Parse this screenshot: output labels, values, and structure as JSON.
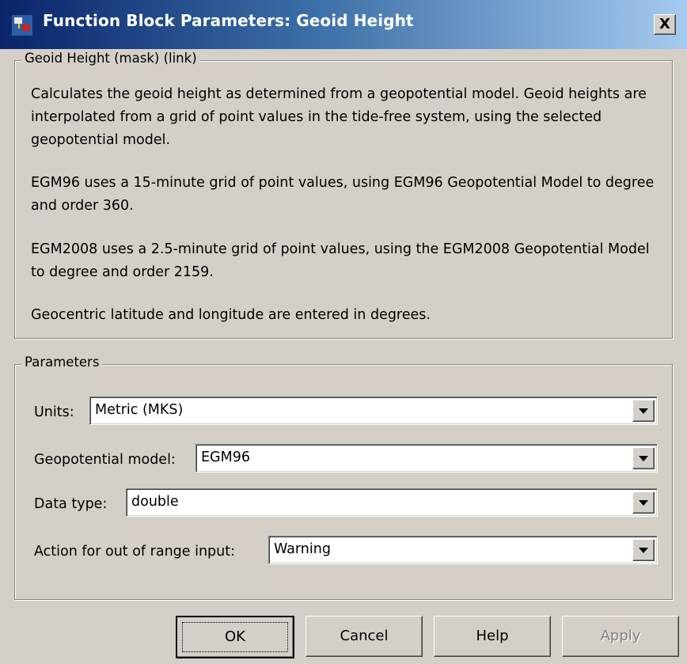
{
  "window": {
    "title": "Function Block Parameters: Geoid Height",
    "close_label": "X"
  },
  "description_group": {
    "legend": "Geoid Height (mask) (link)",
    "paragraphs": [
      "Calculates the geoid height as determined from a geopotential model. Geoid heights are interpolated from a grid of point values in the tide-free system, using the selected geopotential model.",
      "EGM96 uses a 15-minute grid of point values, using EGM96 Geopotential Model to degree and order 360.",
      "EGM2008 uses a 2.5-minute grid of point values, using the EGM2008 Geopotential Model to degree and order 2159.",
      "Geocentric latitude and longitude are entered in degrees."
    ]
  },
  "parameters_group": {
    "legend": "Parameters",
    "fields": [
      {
        "label": "Units:",
        "value": "Metric (MKS)"
      },
      {
        "label": "Geopotential model:",
        "value": "EGM96"
      },
      {
        "label": "Data type:",
        "value": "double"
      },
      {
        "label": "Action for out of range input:",
        "value": "Warning"
      }
    ]
  },
  "buttons": {
    "ok": "OK",
    "cancel": "Cancel",
    "help": "Help",
    "apply": "Apply"
  }
}
